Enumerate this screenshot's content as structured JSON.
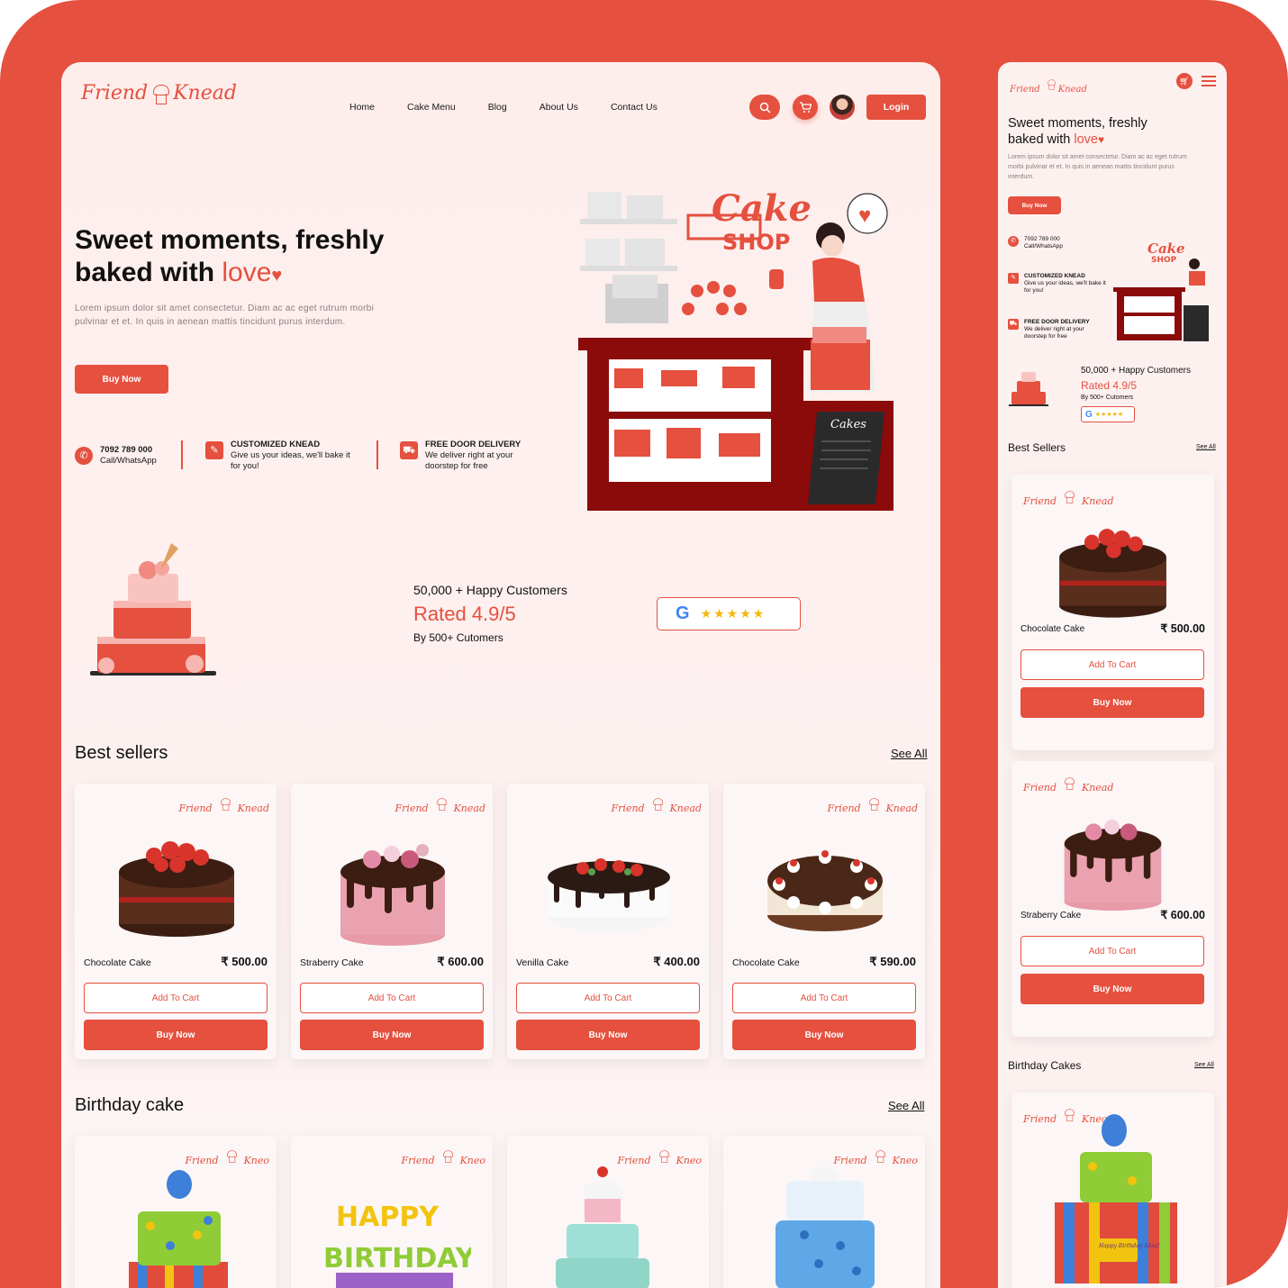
{
  "brand": {
    "logo_left": "Friend",
    "logo_right": "Knead",
    "accent": "#E5503F"
  },
  "nav": {
    "items": [
      "Home",
      "Cake Menu",
      "Blog",
      "About Us",
      "Contact Us"
    ],
    "login_label": "Login"
  },
  "hero": {
    "title_line1": "Sweet moments, freshly",
    "title_line2": "baked with ",
    "title_love": "love",
    "description": "Lorem ipsum dolor sit amet consectetur. Diam ac ac eget rutrum morbi pulvinar et et. In quis in aenean mattis tincidunt purus interdum.",
    "buy_label": "Buy Now",
    "illustration_sign": "Cake",
    "illustration_sign2": "SHOP",
    "illustration_board": "Cakes"
  },
  "features": [
    {
      "title": "7092 789 000",
      "text": "Call/WhatsApp",
      "icon": "whatsapp-icon"
    },
    {
      "title": "CUSTOMIZED KNEAD",
      "text": "Give us your ideas, we'll bake it for you!",
      "icon": "customize-icon"
    },
    {
      "title": "FREE DOOR DELIVERY",
      "text": "We deliver right at your doorstep for free",
      "icon": "truck-icon"
    }
  ],
  "rating": {
    "customers": "50,000 + Happy Customers",
    "rated": "Rated 4.9/5",
    "by": "By 500+ Cutomers",
    "stars": "★★★★★"
  },
  "best_sellers": {
    "title": "Best sellers",
    "see_all": "See All",
    "products": [
      {
        "name": "Chocolate Cake",
        "price": "₹ 500.00"
      },
      {
        "name": "Straberry Cake",
        "price": "₹ 600.00"
      },
      {
        "name": "Venilla Cake",
        "price": "₹ 400.00"
      },
      {
        "name": "Chocolate Cake",
        "price": "₹ 590.00"
      }
    ],
    "add_to_cart": "Add To Cart",
    "buy_now": "Buy Now"
  },
  "birthday": {
    "title": "Birthday cake",
    "see_all": "See All",
    "card_logo": "Friend",
    "card_logo_right": "Kneo"
  },
  "mobile": {
    "title_line1": "Sweet moments, freshly",
    "title_line2": "baked with ",
    "title_love": "love",
    "description": "Lorem ipsum dolor sit amet consectetur. Diam ac ac eget rutrum morbi pulvinar et et. In quis in aenean mattis tincidunt purus interdum.",
    "buy_label": "Buy Now",
    "best_sellers_title": "Best Sellers",
    "see_all": "See All",
    "birthday_title": "Birthday Cakes",
    "products": [
      {
        "name": "Chocolate Cake",
        "price": "₹ 500.00"
      },
      {
        "name": "Straberry Cake",
        "price": "₹ 600.00"
      }
    ],
    "birthday_topper": "Happy Birthday Aliza!"
  }
}
